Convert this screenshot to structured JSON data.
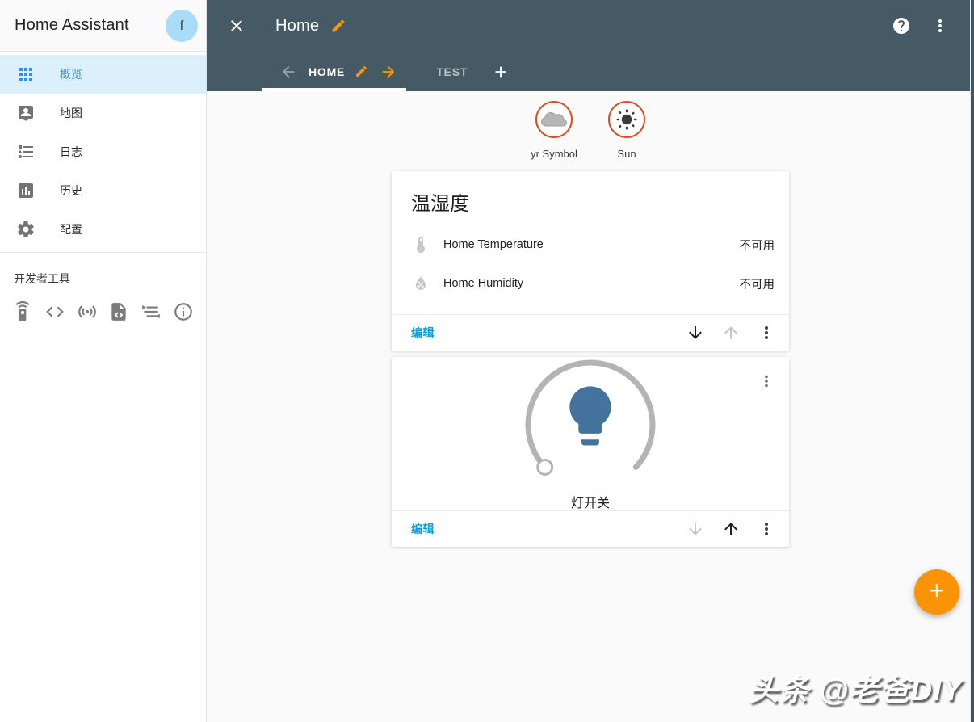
{
  "sidebar": {
    "title": "Home Assistant",
    "avatar_initial": "f",
    "items": [
      {
        "label": "概览",
        "icon": "apps-grid",
        "active": true
      },
      {
        "label": "地图",
        "icon": "account-location",
        "active": false
      },
      {
        "label": "日志",
        "icon": "list-bulleted",
        "active": false
      },
      {
        "label": "历史",
        "icon": "poll-box",
        "active": false
      },
      {
        "label": "配置",
        "icon": "gear",
        "active": false
      }
    ],
    "dev_tools": {
      "label": "开发者工具",
      "icons": [
        "remote",
        "code-tags",
        "access-point",
        "file-code",
        "mqtt",
        "info"
      ]
    }
  },
  "header": {
    "title": "Home",
    "tabs": [
      {
        "label": "HOME",
        "active": true
      },
      {
        "label": "TEST",
        "active": false
      }
    ]
  },
  "badges": [
    {
      "label": "yr Symbol",
      "icon": "cloud"
    },
    {
      "label": "Sun",
      "icon": "sun"
    }
  ],
  "cards": {
    "sensor_card": {
      "title": "温湿度",
      "rows": [
        {
          "icon": "thermometer",
          "name": "Home Temperature",
          "value": "不可用"
        },
        {
          "icon": "water-percent",
          "name": "Home Humidity",
          "value": "不可用"
        }
      ],
      "edit_label": "编辑"
    },
    "light_card": {
      "name": "灯开关",
      "edit_label": "编辑"
    }
  },
  "fab": {
    "label": "+"
  },
  "watermark": "头条 @老爸DIY",
  "colors": {
    "header_bg": "#455a64",
    "accent_orange": "#ff9800",
    "badge_border": "#dd4b1f",
    "fab_orange": "#fb9306",
    "edit_link_blue": "#03a0e0",
    "bulb_blue": "#44739e",
    "active_item_bg": "#dcf0fb"
  }
}
